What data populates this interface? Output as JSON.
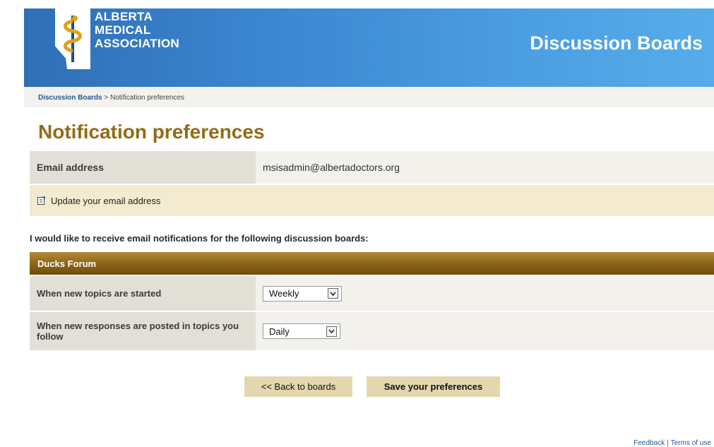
{
  "header": {
    "logo_lines": [
      "ALBERTA",
      "MEDICAL",
      "ASSOCIATION"
    ],
    "site_title": "Discussion Boards"
  },
  "breadcrumb": {
    "root_link": "Discussion Boards",
    "separator": ">",
    "current": "Notification preferences"
  },
  "page": {
    "title": "Notification preferences"
  },
  "email": {
    "label": "Email address",
    "value": "msisadmin@albertadoctors.org",
    "update_link": "Update your email address"
  },
  "instruction": "I would like to receive email notifications for the following discussion boards:",
  "forum": {
    "name": "Ducks Forum",
    "preferences": [
      {
        "label": "When new topics are started",
        "selected": "Weekly"
      },
      {
        "label": "When new responses are posted in topics you follow",
        "selected": "Daily"
      }
    ]
  },
  "buttons": {
    "back": "<< Back to boards",
    "save": "Save your preferences"
  },
  "footer": {
    "feedback": "Feedback",
    "separator": "|",
    "terms": "Terms of use"
  },
  "colors": {
    "header_blue": "#3b86d0",
    "title_gold": "#946b15",
    "section_bar": "#8d6618",
    "button_bg": "#e3d7ae",
    "link_blue": "#25558f"
  },
  "icons": {
    "logo": "alberta-caduceus-logo",
    "update": "edit-note-icon",
    "select": "chevron-down-icon"
  }
}
